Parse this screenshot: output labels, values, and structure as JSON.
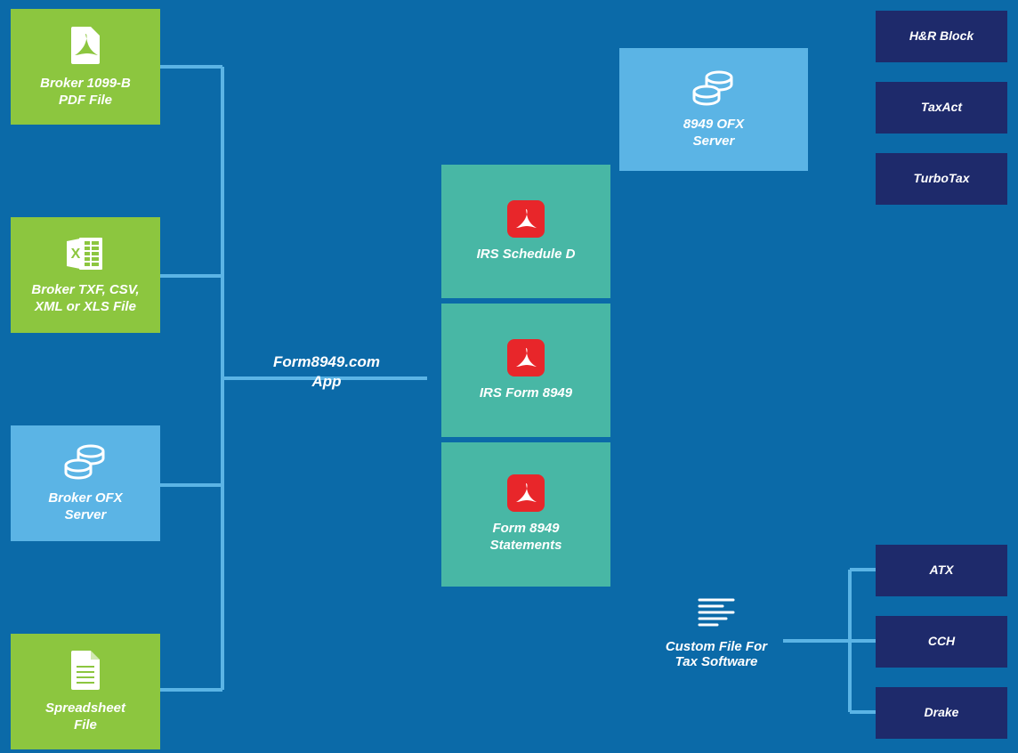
{
  "inputs": {
    "pdf1099b": "Broker 1099-B\nPDF File",
    "txf": "Broker TXF, CSV,\nXML or XLS File",
    "ofxserver": "Broker OFX\nServer",
    "spreadsheet": "Spreadsheet\nFile"
  },
  "center": {
    "app_label": "Form8949.com\nApp",
    "scheduleD": "IRS Schedule D",
    "form8949": "IRS Form 8949",
    "statements": "Form 8949\nStatements"
  },
  "right": {
    "ofxserver": "8949 OFX\nServer",
    "customfile": "Custom File For\nTax Software",
    "tax1": "H&R Block",
    "tax2": "TaxAct",
    "tax3": "TurboTax",
    "pro1": "ATX",
    "pro2": "CCH",
    "pro3": "Drake"
  }
}
